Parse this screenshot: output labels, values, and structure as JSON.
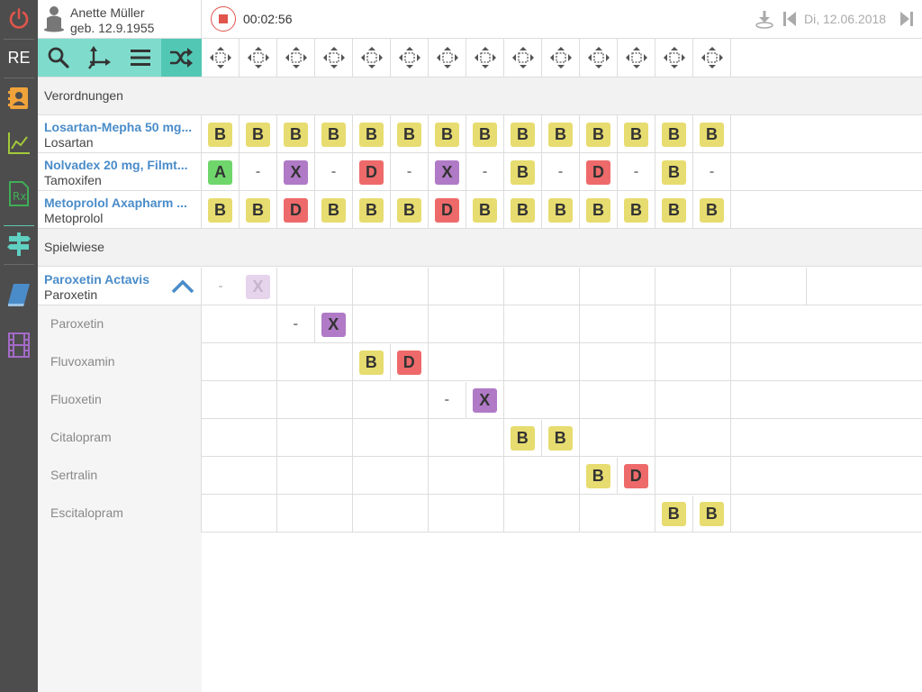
{
  "rail": {
    "re_label": "RE",
    "icons": [
      "power-icon",
      "contacts-icon",
      "chart-icon",
      "prescription-icon",
      "signpost-icon",
      "book-icon",
      "film-icon"
    ]
  },
  "patient": {
    "name": "Anette Müller",
    "dob": "geb. 12.9.1955"
  },
  "session": {
    "timer": "00:02:56"
  },
  "date": {
    "label": "Di, 12.06.2018"
  },
  "toolbar": {
    "tools": [
      "search-icon",
      "axes-icon",
      "menu-icon",
      "shuffle-icon"
    ],
    "active": "shuffle-icon"
  },
  "colors": {
    "B": "#e7dc6f",
    "A": "#6fd66b",
    "X": "#b07ac6",
    "D": "#ee6a6a",
    "toolbar": "#7fdccd",
    "link": "#4a8cc9"
  },
  "sections": {
    "verordnungen": "Verordnungen",
    "spielwiese": "Spielwiese"
  },
  "prescriptions": [
    {
      "brand": "Losartan-Mepha 50 mg...",
      "generic": "Losartan",
      "cells": [
        "B",
        "B",
        "B",
        "B",
        "B",
        "B",
        "B",
        "B",
        "B",
        "B",
        "B",
        "B",
        "B",
        "B"
      ]
    },
    {
      "brand": "Nolvadex 20 mg, Filmt...",
      "generic": "Tamoxifen",
      "cells": [
        "A",
        "-",
        "X",
        "-",
        "D",
        "-",
        "X",
        "-",
        "B",
        "-",
        "D",
        "-",
        "B",
        "-"
      ]
    },
    {
      "brand": "Metoprolol Axapharm ...",
      "generic": "Metoprolol",
      "cells": [
        "B",
        "B",
        "D",
        "B",
        "B",
        "B",
        "D",
        "B",
        "B",
        "B",
        "B",
        "B",
        "B",
        "B"
      ]
    }
  ],
  "playground": {
    "brand": "Paroxetin Actavis",
    "generic": "Paroxetin",
    "cells": [
      "-",
      "X"
    ],
    "alternatives": [
      {
        "name": "Paroxetin",
        "cells": [
          "-",
          "X"
        ]
      },
      {
        "name": "Fluvoxamin",
        "cells": [
          "B",
          "D"
        ]
      },
      {
        "name": "Fluoxetin",
        "cells": [
          "-",
          "X"
        ]
      },
      {
        "name": "Citalopram",
        "cells": [
          "B",
          "B"
        ]
      },
      {
        "name": "Sertralin",
        "cells": [
          "B",
          "D"
        ]
      },
      {
        "name": "Escitalopram",
        "cells": [
          "B",
          "B"
        ]
      }
    ]
  }
}
